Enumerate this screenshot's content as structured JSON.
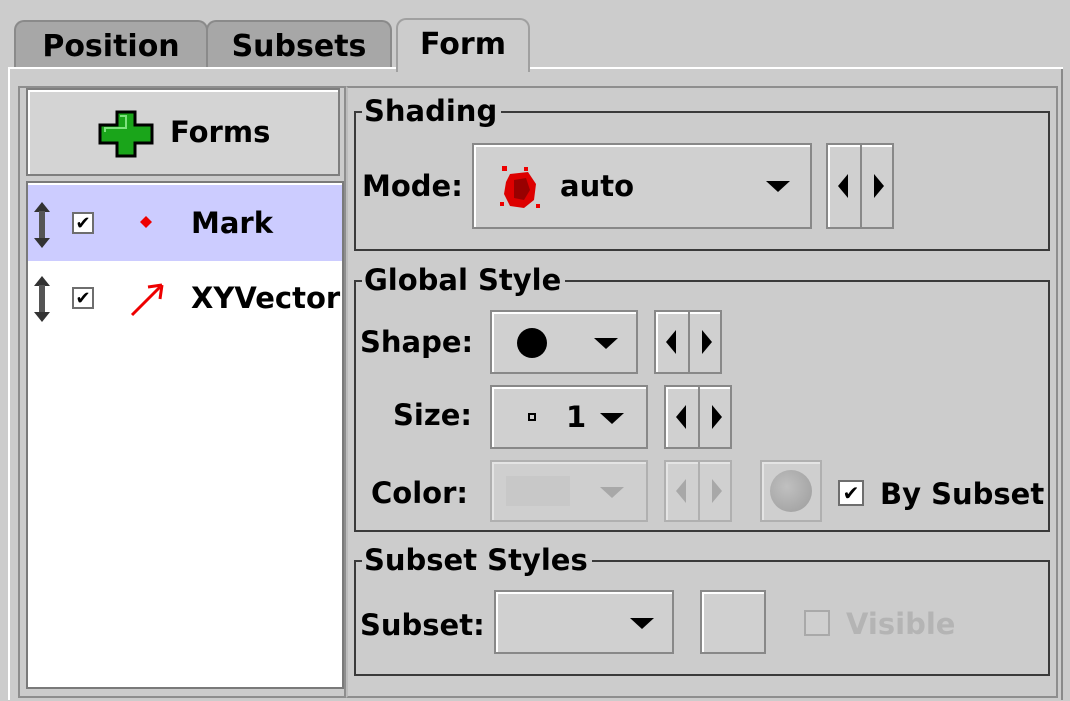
{
  "tabs": [
    {
      "label": "Position"
    },
    {
      "label": "Subsets"
    },
    {
      "label": "Form"
    }
  ],
  "forms_button": {
    "label": "Forms",
    "icon": "plus-icon",
    "icon_color": "#1aa51a"
  },
  "layers": [
    {
      "label": "Mark",
      "checked": true,
      "icon": "red-dot-icon",
      "selected": true
    },
    {
      "label": "XYVector",
      "checked": true,
      "icon": "red-arrow-icon",
      "selected": false
    }
  ],
  "shading": {
    "title": "Shading",
    "mode_label": "Mode:",
    "mode_value": "auto",
    "mode_icon": "red-splat-icon"
  },
  "global_style": {
    "title": "Global Style",
    "shape_label": "Shape:",
    "shape_value_icon": "filled-circle-icon",
    "size_label": "Size:",
    "size_value": "1",
    "color_label": "Color:",
    "by_subset_label": "By Subset",
    "by_subset_checked": true
  },
  "subset_styles": {
    "title": "Subset Styles",
    "subset_label": "Subset:",
    "visible_label": "Visible",
    "visible_checked": false
  },
  "colors": {
    "selection": "#ccccff",
    "accent_red": "#ee0000",
    "plus_green": "#1aa51a"
  }
}
